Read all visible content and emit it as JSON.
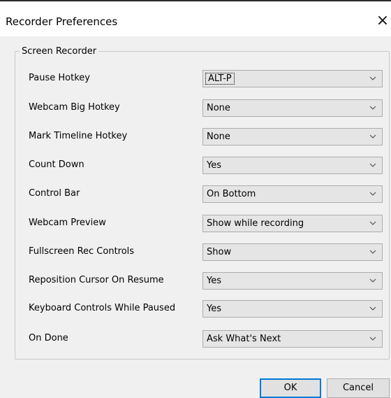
{
  "window": {
    "title": "Recorder Preferences",
    "close_glyph": "×"
  },
  "group": {
    "legend": "Screen Recorder"
  },
  "rows": [
    {
      "label": "Pause Hotkey",
      "value": "ALT-P",
      "focused": true
    },
    {
      "label": "Webcam Big Hotkey",
      "value": "None"
    },
    {
      "label": "Mark Timeline Hotkey",
      "value": "None"
    },
    {
      "label": "Count Down",
      "value": "Yes"
    },
    {
      "label": "Control Bar",
      "value": "On Bottom"
    },
    {
      "label": "Webcam Preview",
      "value": "Show while recording"
    },
    {
      "label": "Fullscreen Rec Controls",
      "value": "Show"
    },
    {
      "label": "Reposition Cursor On Resume",
      "value": "Yes"
    },
    {
      "label": "Keyboard Controls While Paused",
      "value": "Yes"
    },
    {
      "label": "On Done",
      "value": "Ask What's Next"
    }
  ],
  "buttons": {
    "ok": "OK",
    "cancel": "Cancel"
  }
}
